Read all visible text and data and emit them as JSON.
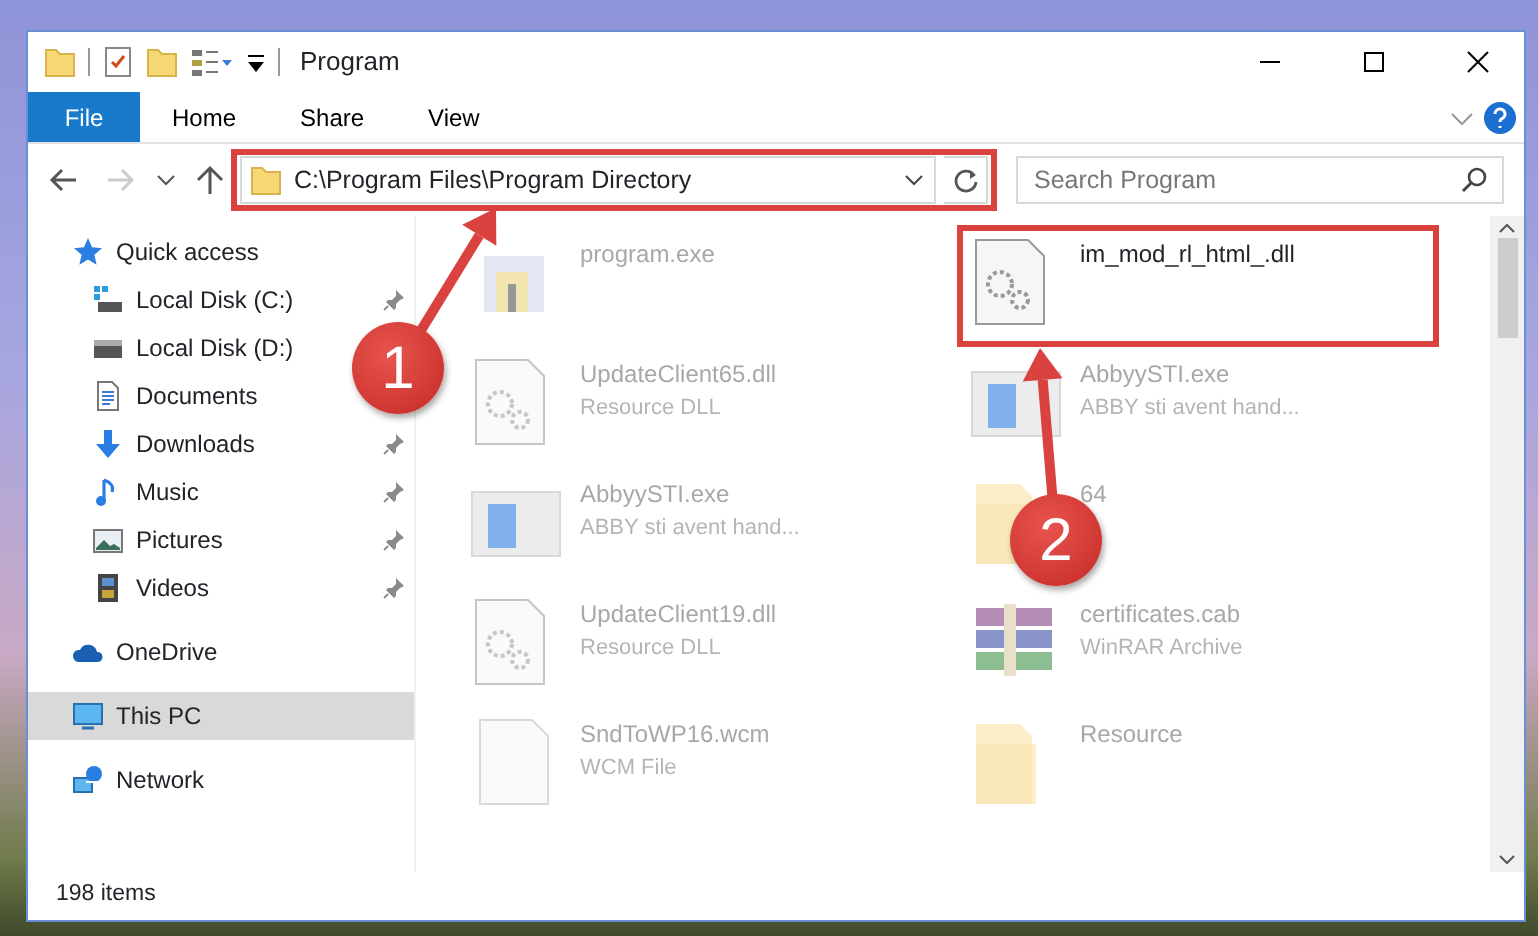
{
  "window": {
    "title": "Program"
  },
  "tabs": [
    {
      "label": "File",
      "kind": "file",
      "selected": false
    },
    {
      "label": "Home",
      "kind": "tab",
      "selected": false
    },
    {
      "label": "Share",
      "kind": "tab",
      "selected": false
    },
    {
      "label": "View",
      "kind": "tab",
      "selected": false
    }
  ],
  "address": {
    "path": "C:\\Program Files\\Program Directory",
    "highlighted": true,
    "step": "1"
  },
  "search": {
    "placeholder": "Search Program"
  },
  "sidebar": {
    "items": [
      {
        "label": "Quick access",
        "kind": "star",
        "selected": false,
        "children": [
          {
            "label": "Local Disk (C:)",
            "kind": "drive-c",
            "pinned": true,
            "selected": false
          },
          {
            "label": "Local Disk (D:)",
            "kind": "drive",
            "pinned": false,
            "selected": false
          },
          {
            "label": "Documents",
            "kind": "documents",
            "pinned": false,
            "selected": false
          },
          {
            "label": "Downloads",
            "kind": "downloads",
            "pinned": true,
            "selected": false
          },
          {
            "label": "Music",
            "kind": "music",
            "pinned": true,
            "selected": false
          },
          {
            "label": "Pictures",
            "kind": "pictures",
            "pinned": true,
            "selected": false
          },
          {
            "label": "Videos",
            "kind": "videos",
            "pinned": true,
            "selected": false
          }
        ]
      },
      {
        "label": "OneDrive",
        "kind": "cloud",
        "selected": false
      },
      {
        "label": "This PC",
        "kind": "pc",
        "selected": true
      },
      {
        "label": "Network",
        "kind": "network",
        "selected": false
      }
    ]
  },
  "files": [
    {
      "name": "program.exe",
      "kind": "installer",
      "blurred": true,
      "highlighted": false
    },
    {
      "name": "im_mod_rl_html_.dll",
      "kind": "dll",
      "blurred": false,
      "highlighted": true,
      "step": "2"
    },
    {
      "name": "UpdateClient65.dll",
      "description": "Resource DLL",
      "kind": "dll",
      "blurred": true,
      "highlighted": false
    },
    {
      "name": "AbbyySTI.exe",
      "description": "ABBY sti avent hand...",
      "kind": "app",
      "blurred": true,
      "highlighted": false
    },
    {
      "name": "AbbyySTI.exe",
      "description": "ABBY sti avent hand...",
      "kind": "app",
      "blurred": true,
      "highlighted": false
    },
    {
      "name": "64",
      "kind": "folder",
      "blurred": true,
      "highlighted": false
    },
    {
      "name": "UpdateClient19.dll",
      "description": "Resource DLL",
      "kind": "dll",
      "blurred": true,
      "highlighted": false
    },
    {
      "name": "certificates.cab",
      "description": "WinRAR Archive",
      "kind": "archive",
      "blurred": true,
      "highlighted": false
    },
    {
      "name": "SndToWP16.wcm",
      "description": "WCM File",
      "kind": "blank",
      "blurred": true,
      "highlighted": false
    },
    {
      "name": "Resource",
      "kind": "folder",
      "blurred": true,
      "highlighted": false
    }
  ],
  "status_bar": {
    "text": "198 items"
  }
}
